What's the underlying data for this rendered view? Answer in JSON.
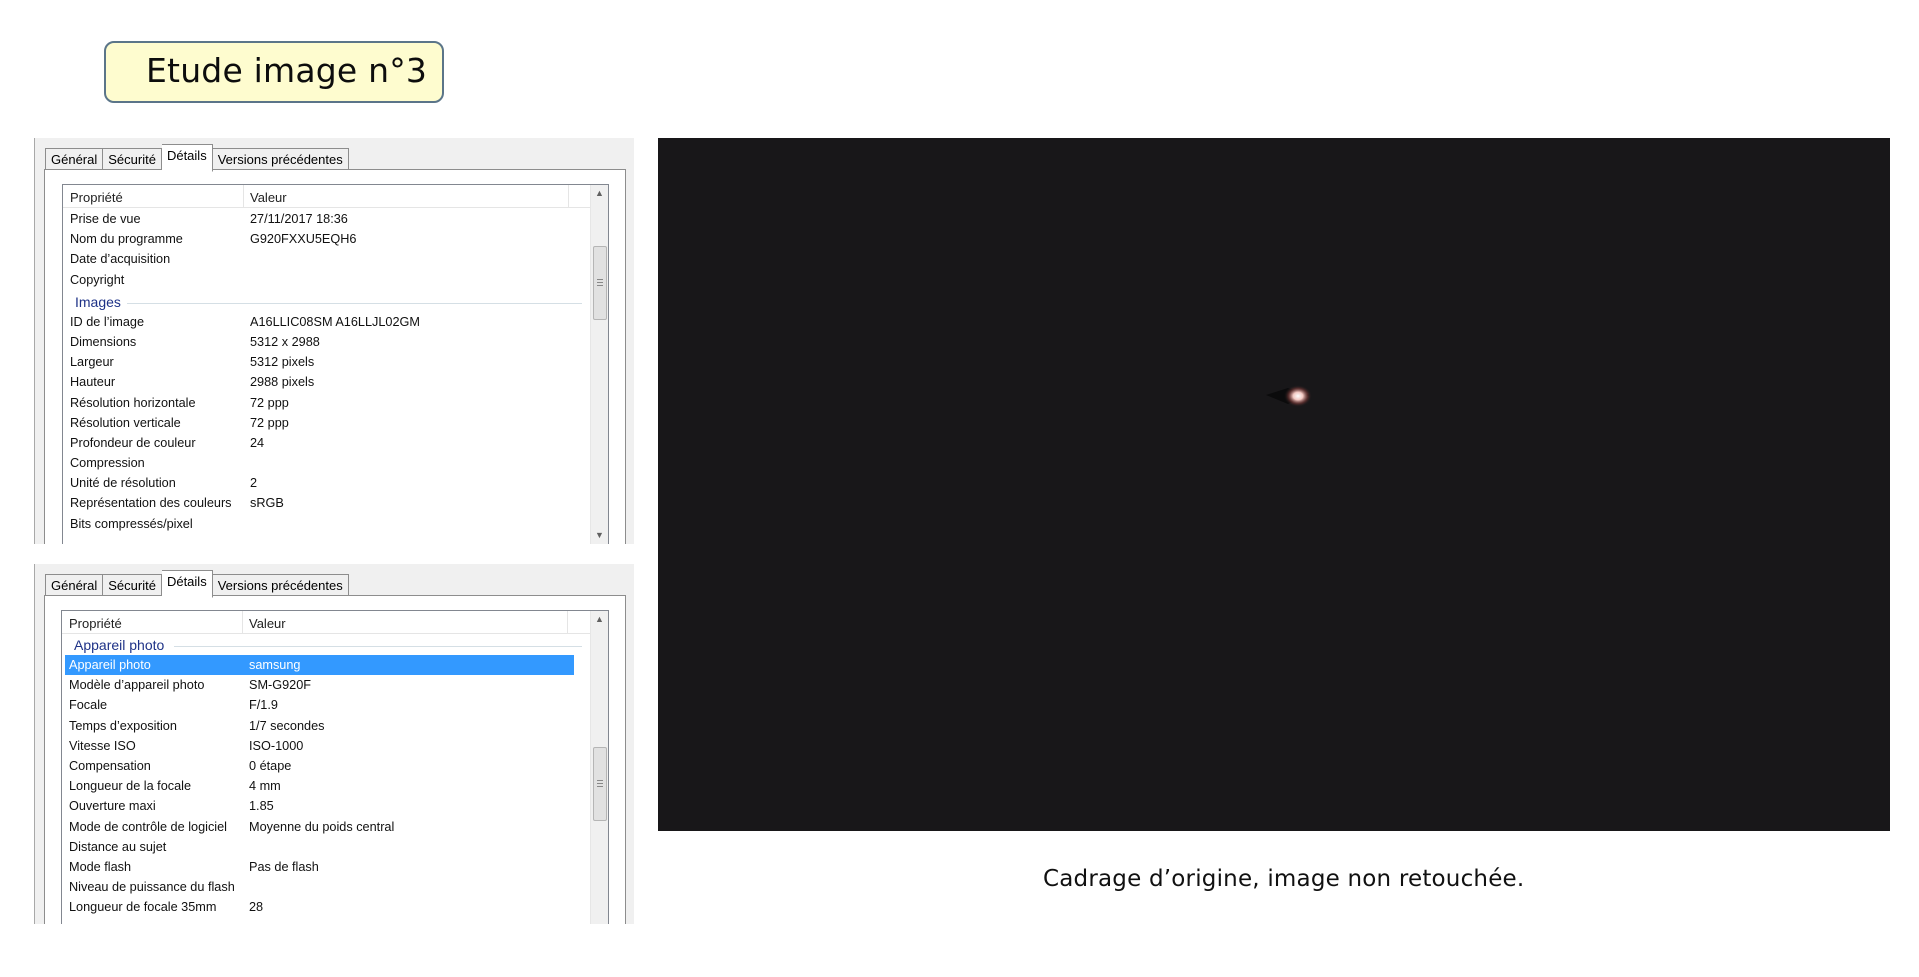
{
  "title": "Etude image n°3",
  "caption": "Cadrage d’origine, image non retouchée.",
  "panel_top": {
    "tabs": [
      "Général",
      "Sécurité",
      "Détails",
      "Versions précédentes"
    ],
    "active_tab": "Détails",
    "columns": {
      "property": "Propriété",
      "value": "Valeur"
    },
    "rows_before_group": [
      {
        "k": "Prise de vue",
        "v": "27/11/2017 18:36"
      },
      {
        "k": "Nom du programme",
        "v": "G920FXXU5EQH6"
      },
      {
        "k": "Date d’acquisition",
        "v": ""
      },
      {
        "k": "Copyright",
        "v": ""
      }
    ],
    "group_label": "Images",
    "rows_after_group": [
      {
        "k": "ID de l’image",
        "v": "A16LLIC08SM A16LLJL02GM"
      },
      {
        "k": "Dimensions",
        "v": "5312 x 2988"
      },
      {
        "k": "Largeur",
        "v": "5312 pixels"
      },
      {
        "k": "Hauteur",
        "v": "2988 pixels"
      },
      {
        "k": "Résolution horizontale",
        "v": "72 ppp"
      },
      {
        "k": "Résolution verticale",
        "v": "72 ppp"
      },
      {
        "k": "Profondeur de couleur",
        "v": "24"
      },
      {
        "k": "Compression",
        "v": ""
      },
      {
        "k": "Unité de résolution",
        "v": "2"
      },
      {
        "k": "Représentation des couleurs",
        "v": "sRGB"
      },
      {
        "k": "Bits compressés/pixel",
        "v": ""
      }
    ]
  },
  "panel_bottom": {
    "tabs": [
      "Général",
      "Sécurité",
      "Détails",
      "Versions précédentes"
    ],
    "active_tab": "Détails",
    "columns": {
      "property": "Propriété",
      "value": "Valeur"
    },
    "group_label": "Appareil photo",
    "selected_row": {
      "k": "Appareil photo",
      "v": "samsung"
    },
    "rows": [
      {
        "k": "Modèle d’appareil photo",
        "v": "SM-G920F"
      },
      {
        "k": "Focale",
        "v": "F/1.9"
      },
      {
        "k": "Temps d’exposition",
        "v": "1/7 secondes"
      },
      {
        "k": "Vitesse ISO",
        "v": "ISO-1000"
      },
      {
        "k": "Compensation",
        "v": "0 étape"
      },
      {
        "k": "Longueur de la focale",
        "v": "4 mm"
      },
      {
        "k": "Ouverture maxi",
        "v": "1.85"
      },
      {
        "k": "Mode de contrôle de logiciel",
        "v": "Moyenne du poids central"
      },
      {
        "k": "Distance au sujet",
        "v": ""
      },
      {
        "k": "Mode flash",
        "v": "Pas de flash"
      },
      {
        "k": "Niveau de puissance du flash",
        "v": ""
      },
      {
        "k": "Longueur de focale 35mm",
        "v": "28"
      }
    ]
  },
  "colors": {
    "title_bg": "#fefccf",
    "title_border": "#5b7589",
    "selection": "#3399ff",
    "group_label": "#1e3287",
    "photo_bg": "#181719"
  },
  "icons": [
    "scroll-up-arrow-icon",
    "scroll-down-arrow-icon",
    "scrollbar-grip-icon"
  ]
}
